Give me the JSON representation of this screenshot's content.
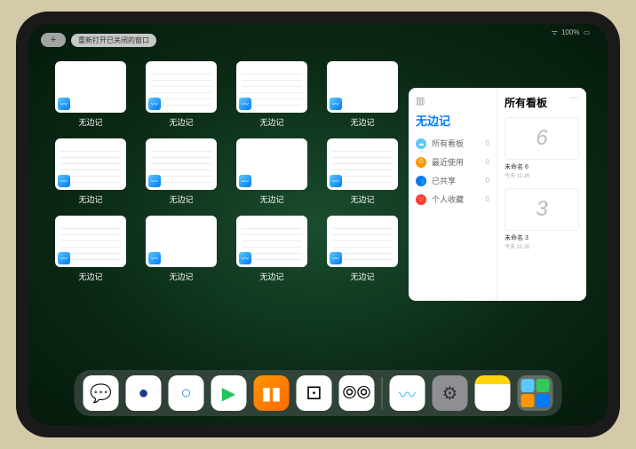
{
  "status": {
    "wifi": "⌁",
    "battery": "100%"
  },
  "topControls": {
    "plus": "+",
    "reopen": "重新打开已关闭的窗口"
  },
  "appWindows": {
    "label": "无边记",
    "count": 12,
    "mixedTypes": [
      "blank",
      "calendar",
      "calendar",
      "blank",
      "calendar",
      "calendar",
      "blank",
      "calendar",
      "calendar",
      "blank",
      "calendar",
      "calendar"
    ]
  },
  "panel": {
    "leftTitle": "无边记",
    "items": [
      {
        "icon": "☁",
        "color": "#5ac8fa",
        "label": "所有看板",
        "count": 0
      },
      {
        "icon": "⏱",
        "color": "#ff9500",
        "label": "最近使用",
        "count": 0
      },
      {
        "icon": "👥",
        "color": "#007aff",
        "label": "已共享",
        "count": 0
      },
      {
        "icon": "♡",
        "color": "#ff3b30",
        "label": "个人收藏",
        "count": 0
      }
    ],
    "rightTitle": "所有看板",
    "boards": [
      {
        "glyph": "6",
        "name": "未命名 6",
        "date": "今天 11:26"
      },
      {
        "glyph": "3",
        "name": "未命名 3",
        "date": "今天 11:26"
      }
    ]
  },
  "dock": [
    {
      "name": "wechat",
      "bg": "#ffffff",
      "glyph": "💬",
      "glyphColor": "#07c160"
    },
    {
      "name": "app-blue-dot",
      "bg": "#ffffff",
      "glyph": "●",
      "glyphColor": "#1e3a8a"
    },
    {
      "name": "browser",
      "bg": "#ffffff",
      "glyph": "○",
      "glyphColor": "#3b82f6"
    },
    {
      "name": "play",
      "bg": "#ffffff",
      "glyph": "▶",
      "glyphColor": "#22c55e"
    },
    {
      "name": "books",
      "bg": "linear-gradient(135deg,#ff9500,#ff6b00)",
      "glyph": "▮▮",
      "glyphColor": "#fff"
    },
    {
      "name": "dice",
      "bg": "#ffffff",
      "glyph": "⚀",
      "glyphColor": "#000"
    },
    {
      "name": "dots",
      "bg": "#ffffff",
      "glyph": "⦾⦾",
      "glyphColor": "#000"
    },
    {
      "name": "freeform",
      "bg": "#ffffff",
      "glyph": "〰",
      "glyphColor": "#5ac8fa"
    },
    {
      "name": "settings",
      "bg": "#8e8e93",
      "glyph": "⚙",
      "glyphColor": "#333"
    },
    {
      "name": "notes",
      "bg": "linear-gradient(#ffd60a 25%,#fff 25%)",
      "glyph": "",
      "glyphColor": ""
    },
    {
      "name": "app-library",
      "bg": "rgba(255,255,255,0.25)",
      "glyph": "grid",
      "glyphColor": ""
    }
  ]
}
